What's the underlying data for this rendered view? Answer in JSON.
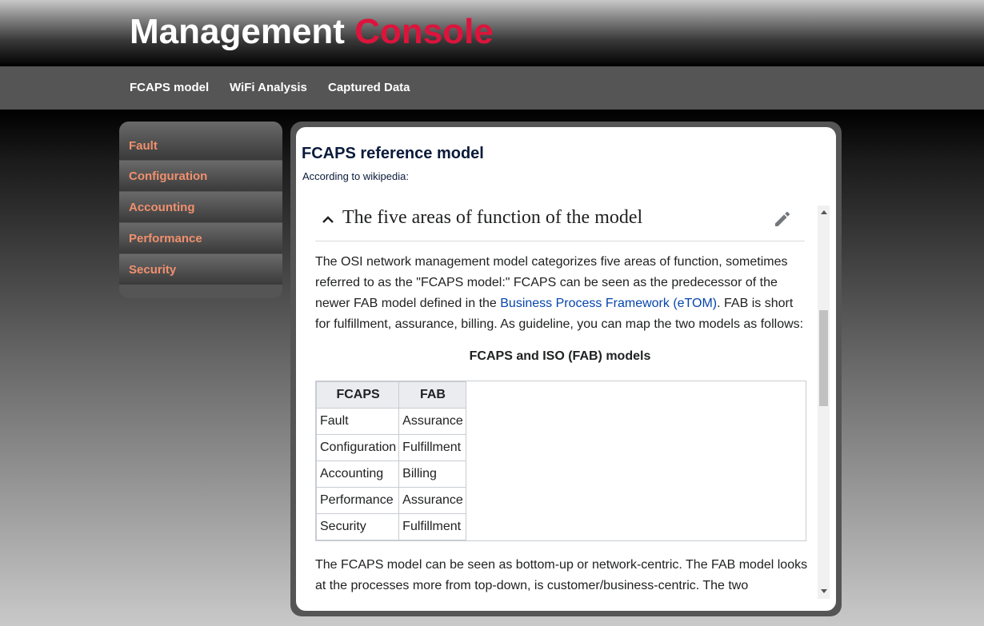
{
  "app": {
    "title_part1": "Management",
    "title_part2": "Console",
    "accent_color": "#dc143c"
  },
  "nav": {
    "items": [
      "FCAPS model",
      "WiFi Analysis",
      "Captured Data"
    ]
  },
  "sidebar": {
    "items": [
      "Fault",
      "Configuration",
      "Accounting",
      "Performance",
      "Security"
    ],
    "link_color": "#f0906e"
  },
  "content": {
    "title": "FCAPS reference model",
    "intro": "According to wikipedia:"
  },
  "wiki": {
    "section_title": "The five areas of function of the model",
    "para1_before_link": "The OSI network management model categorizes five areas of function, sometimes referred to as the \"FCAPS model:\" FCAPS can be seen as the predecessor of the newer FAB model defined in the ",
    "para1_link": "Business Process Framework (eTOM)",
    "para1_after_link": ". FAB is short for fulfillment, assurance, billing. As guideline, you can map the two models as follows:",
    "table_caption": "FCAPS and ISO (FAB) models",
    "table_headers": [
      "FCAPS",
      "FAB"
    ],
    "table_rows": [
      [
        "Fault",
        "Assurance"
      ],
      [
        "Configuration",
        "Fulfillment"
      ],
      [
        "Accounting",
        "Billing"
      ],
      [
        "Performance",
        "Assurance"
      ],
      [
        "Security",
        "Fulfillment"
      ]
    ],
    "para2": "The FCAPS model can be seen as bottom-up or network-centric. The FAB model looks at the processes more from top-down, is customer/business-centric. The two"
  },
  "icons": {
    "collapse": "chevron-up-icon",
    "edit": "pencil-icon"
  }
}
